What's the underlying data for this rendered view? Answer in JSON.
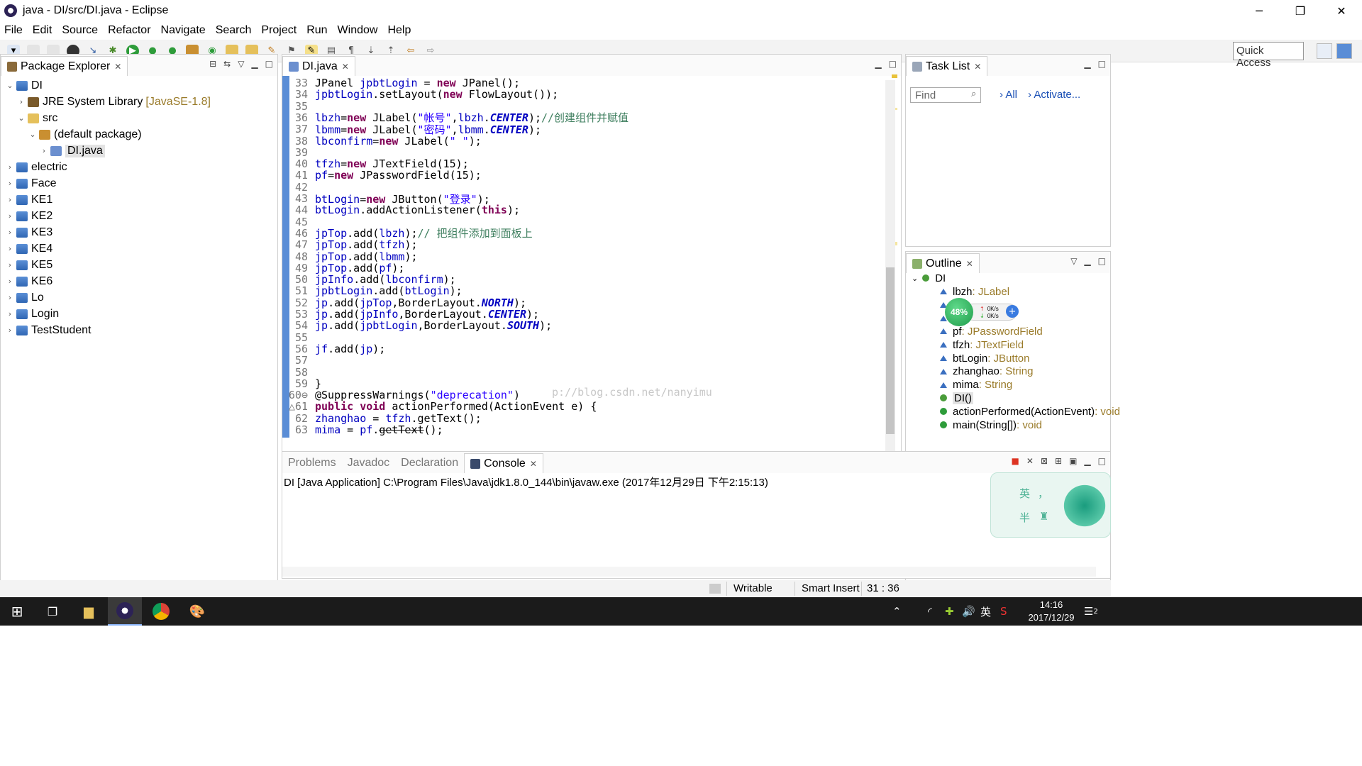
{
  "window": {
    "title": "java - DI/src/DI.java - Eclipse",
    "minimize": "─",
    "restore": "❐",
    "close": "✕"
  },
  "menu": [
    "File",
    "Edit",
    "Source",
    "Refactor",
    "Navigate",
    "Search",
    "Project",
    "Run",
    "Window",
    "Help"
  ],
  "toolbar": {
    "quick_access": "Quick Access"
  },
  "package_explorer": {
    "tab": "Package Explorer",
    "items": [
      {
        "label": "DI",
        "expanded": true
      },
      {
        "label": "JRE System Library",
        "version": "[JavaSE-1.8]"
      },
      {
        "label": "src",
        "expanded": true
      },
      {
        "label": "(default package)",
        "expanded": true
      },
      {
        "label": "DI.java"
      },
      {
        "label": "electric"
      },
      {
        "label": "Face"
      },
      {
        "label": "KE1"
      },
      {
        "label": "KE2"
      },
      {
        "label": "KE3"
      },
      {
        "label": "KE4"
      },
      {
        "label": "KE5"
      },
      {
        "label": "KE6"
      },
      {
        "label": "Lo"
      },
      {
        "label": "Login"
      },
      {
        "label": "TestStudent"
      }
    ]
  },
  "editor": {
    "tab": "DI.java",
    "watermark": "p://blog.csdn.net/nanyimu",
    "lines": [
      {
        "n": "33",
        "code": "JPanel jpbtLogin = new JPanel();"
      },
      {
        "n": "34",
        "code": "jpbtLogin.setLayout(new FlowLayout());"
      },
      {
        "n": "35",
        "code": ""
      },
      {
        "n": "36",
        "code": "lbzh=new JLabel(\"帐号\",lbzh.CENTER);//创建组件并赋值"
      },
      {
        "n": "37",
        "code": "lbmm=new JLabel(\"密码\",lbmm.CENTER);"
      },
      {
        "n": "38",
        "code": "lbconfirm=new JLabel(\" \");"
      },
      {
        "n": "39",
        "code": ""
      },
      {
        "n": "40",
        "code": "tfzh=new JTextField(15);"
      },
      {
        "n": "41",
        "code": "pf=new JPasswordField(15);"
      },
      {
        "n": "42",
        "code": ""
      },
      {
        "n": "43",
        "code": "btLogin=new JButton(\"登录\");"
      },
      {
        "n": "44",
        "code": "btLogin.addActionListener(this);"
      },
      {
        "n": "45",
        "code": ""
      },
      {
        "n": "46",
        "code": "jpTop.add(lbzh);// 把组件添加到面板上"
      },
      {
        "n": "47",
        "code": "jpTop.add(tfzh);"
      },
      {
        "n": "48",
        "code": "jpTop.add(lbmm);"
      },
      {
        "n": "49",
        "code": "jpTop.add(pf);"
      },
      {
        "n": "50",
        "code": "jpInfo.add(lbconfirm);"
      },
      {
        "n": "51",
        "code": "jpbtLogin.add(btLogin);"
      },
      {
        "n": "52",
        "code": "jp.add(jpTop,BorderLayout.NORTH);"
      },
      {
        "n": "53",
        "code": "jp.add(jpInfo,BorderLayout.CENTER);"
      },
      {
        "n": "54",
        "code": "jp.add(jpbtLogin,BorderLayout.SOUTH);"
      },
      {
        "n": "55",
        "code": ""
      },
      {
        "n": "56",
        "code": "jf.add(jp);"
      },
      {
        "n": "57",
        "code": ""
      },
      {
        "n": "58",
        "code": ""
      },
      {
        "n": "59",
        "code": "}"
      },
      {
        "n": "60⊖",
        "code": "@SuppressWarnings(\"deprecation\")"
      },
      {
        "n": "△61",
        "code": "public void actionPerformed(ActionEvent e) {"
      },
      {
        "n": "62",
        "code": "zhanghao = tfzh.getText();"
      },
      {
        "n": "63",
        "code": "mima = pf.getText();"
      }
    ]
  },
  "task_list": {
    "tab": "Task List",
    "find_placeholder": "Find",
    "all": "All",
    "activate": "Activate..."
  },
  "outline": {
    "tab": "Outline",
    "root": "DI",
    "items": [
      {
        "name": "lbzh",
        "type": " : JLabel"
      },
      {
        "name": "",
        "type": "bel"
      },
      {
        "name": "",
        "type": ""
      },
      {
        "name": "pf",
        "type": " : JPasswordField"
      },
      {
        "name": "tfzh",
        "type": " : JTextField"
      },
      {
        "name": "btLogin",
        "type": " : JButton"
      },
      {
        "name": "zhanghao",
        "type": " : String"
      },
      {
        "name": "mima",
        "type": " : String"
      },
      {
        "name": "DI()",
        "type": ""
      },
      {
        "name": "actionPerformed(ActionEvent)",
        "type": " : void"
      },
      {
        "name": "main(String[])",
        "type": " : void"
      }
    ]
  },
  "console": {
    "tabs": [
      "Problems",
      "Javadoc",
      "Declaration",
      "Console"
    ],
    "active_tab": "Console",
    "text": "DI [Java Application] C:\\Program Files\\Java\\jdk1.8.0_144\\bin\\javaw.exe (2017年12月29日 下午2:15:13)"
  },
  "statusbar": {
    "mode": "Writable",
    "insert": "Smart Insert",
    "position": "31 : 36"
  },
  "net_widget": {
    "percent": "48%",
    "up": "0K/s",
    "down": "0K/s"
  },
  "ime": {
    "char1": "英",
    "char2": "，",
    "char3": "半"
  },
  "taskbar": {
    "time": "14:16",
    "date": "2017/12/29",
    "lang": "英",
    "notif": "2"
  },
  "colors": {
    "keyword": "#7f0055",
    "field": "#0000c0",
    "string": "#2a00ff",
    "comment": "#3f7f5f",
    "accent": "#5a8dd6"
  }
}
